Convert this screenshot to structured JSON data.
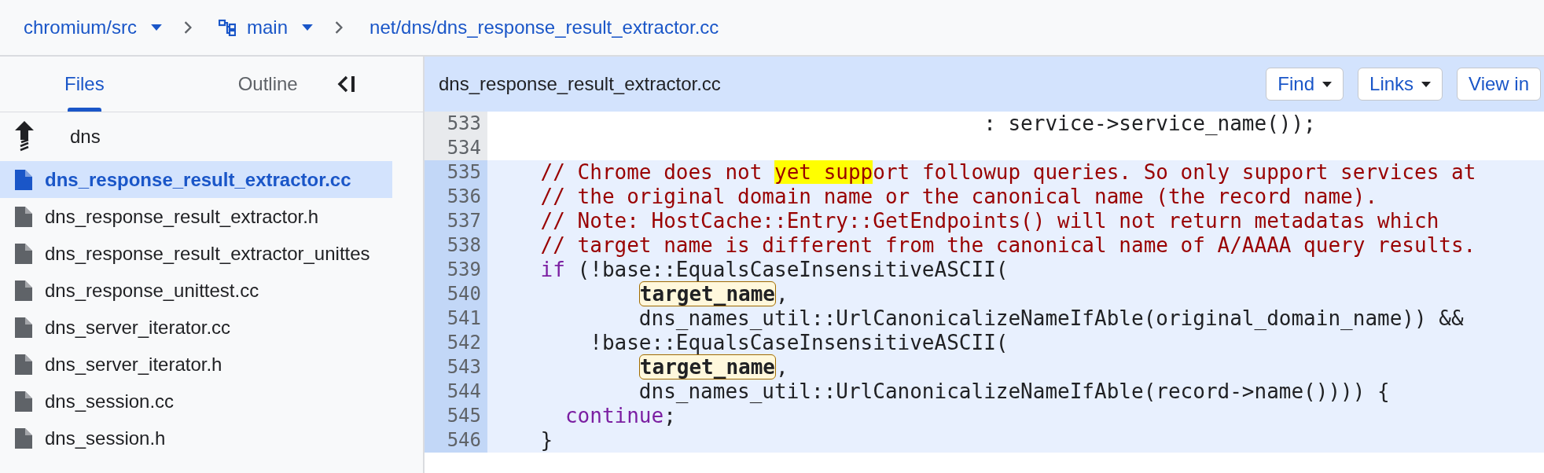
{
  "breadcrumb": {
    "repo": "chromium/src",
    "branch": "main",
    "path": "net/dns/dns_response_result_extractor.cc"
  },
  "sidebar": {
    "tabs": [
      {
        "label": "Files",
        "selected": true
      },
      {
        "label": "Outline",
        "selected": false
      }
    ],
    "parent": "dns",
    "files": [
      {
        "name": "dns_response_result_extractor.cc",
        "selected": true
      },
      {
        "name": "dns_response_result_extractor.h",
        "selected": false
      },
      {
        "name": "dns_response_result_extractor_unittes",
        "selected": false
      },
      {
        "name": "dns_response_unittest.cc",
        "selected": false
      },
      {
        "name": "dns_server_iterator.cc",
        "selected": false
      },
      {
        "name": "dns_server_iterator.h",
        "selected": false
      },
      {
        "name": "dns_session.cc",
        "selected": false
      },
      {
        "name": "dns_session.h",
        "selected": false
      }
    ]
  },
  "editor": {
    "filename": "dns_response_result_extractor.cc",
    "buttons": [
      {
        "label": "Find",
        "dropdown": true
      },
      {
        "label": "Links",
        "dropdown": true
      },
      {
        "label": "View in",
        "dropdown": false
      }
    ],
    "lines": [
      {
        "number": "533",
        "selected": false,
        "segments": [
          {
            "kind": "plain",
            "text": "                                        : service->service_name());"
          }
        ]
      },
      {
        "number": "534",
        "selected": false
      },
      {
        "number": "535",
        "selected": true,
        "segments": [
          {
            "kind": "comment",
            "text": "    // Chrome does not "
          },
          {
            "kind": "match",
            "text": "yet supp"
          },
          {
            "kind": "comment",
            "text": "ort followup queries. So only support services at"
          }
        ]
      },
      {
        "number": "536",
        "selected": true,
        "segments": [
          {
            "kind": "comment",
            "text": "    // the original domain name or the canonical name (the record name)."
          }
        ]
      },
      {
        "number": "537",
        "selected": true,
        "segments": [
          {
            "kind": "comment",
            "text": "    // Note: HostCache::Entry::GetEndpoints() will not return metadatas which"
          }
        ]
      },
      {
        "number": "538",
        "selected": true,
        "segments": [
          {
            "kind": "comment",
            "text": "    // target name is different from the canonical name of A/AAAA query results."
          }
        ]
      },
      {
        "number": "539",
        "selected": true,
        "segments": [
          {
            "kind": "keyword",
            "text": "    if"
          },
          {
            "kind": "plain",
            "text": " (!base::EqualsCaseInsensitiveASCII("
          }
        ]
      },
      {
        "number": "540",
        "selected": true,
        "kind": "argument",
        "segments": [
          {
            "kind": "ref",
            "text": "target_name"
          },
          {
            "kind": "plain",
            "text": ","
          }
        ]
      },
      {
        "number": "541",
        "selected": true,
        "segments": [
          {
            "kind": "plain",
            "text": "            dns_names_util::UrlCanonicalizeNameIfAble(original_domain_name)) &&"
          }
        ]
      },
      {
        "number": "542",
        "selected": true,
        "segments": [
          {
            "kind": "plain",
            "text": "        !base::EqualsCaseInsensitiveASCII("
          }
        ]
      },
      {
        "number": "543",
        "selected": true,
        "kind": "argument",
        "segments": [
          {
            "kind": "ref",
            "text": "target_name"
          },
          {
            "kind": "plain",
            "text": ","
          }
        ]
      },
      {
        "number": "544",
        "selected": true,
        "segments": [
          {
            "kind": "plain",
            "text": "            dns_names_util::UrlCanonicalizeNameIfAble(record->name()))) {"
          }
        ]
      },
      {
        "number": "545",
        "selected": true,
        "segments": [
          {
            "kind": "keyword",
            "text": "      continue"
          },
          {
            "kind": "plain",
            "text": ";"
          }
        ]
      },
      {
        "number": "546",
        "selected": true,
        "segments": [
          {
            "kind": "plain",
            "text": "    }"
          }
        ]
      }
    ]
  }
}
